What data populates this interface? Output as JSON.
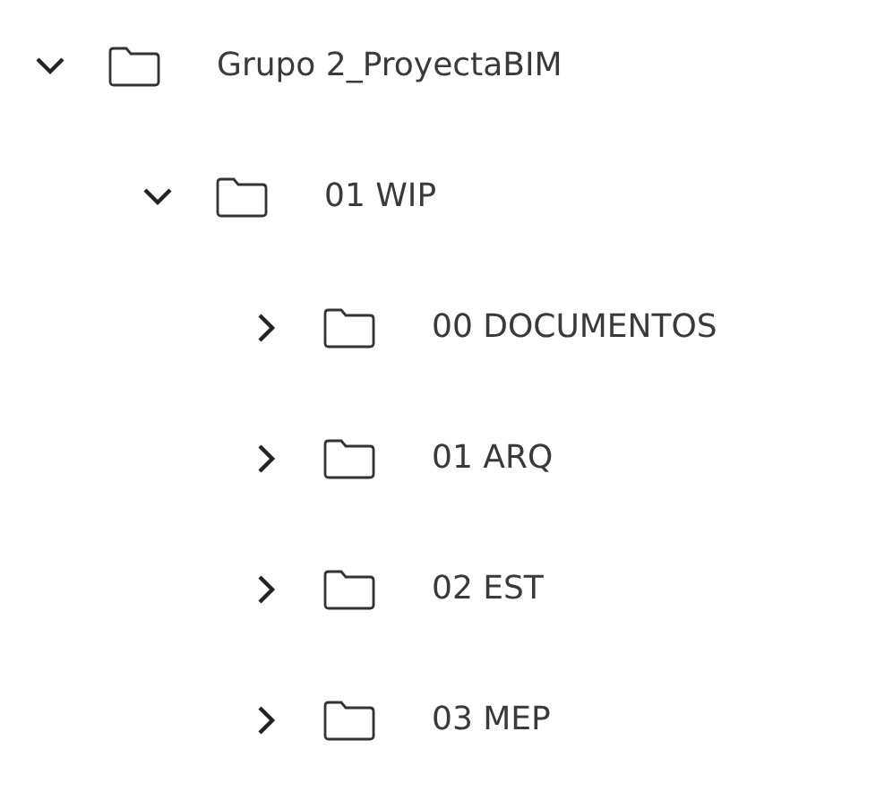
{
  "tree": [
    {
      "name": "Grupo 2_ProyectaBIM",
      "expanded": true,
      "children": [
        {
          "name": "01 WIP",
          "expanded": true,
          "children": [
            {
              "name": "00 DOCUMENTOS",
              "expanded": false
            },
            {
              "name": "01 ARQ",
              "expanded": false
            },
            {
              "name": "02 EST",
              "expanded": false
            },
            {
              "name": "03 MEP",
              "expanded": false
            }
          ]
        }
      ]
    }
  ]
}
